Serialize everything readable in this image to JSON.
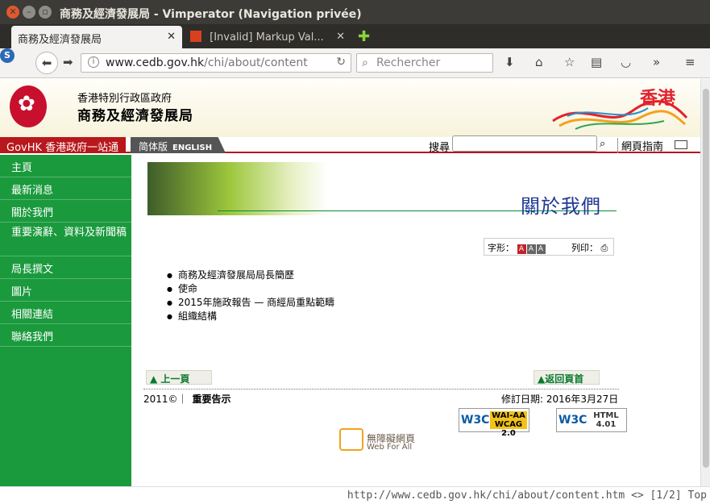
{
  "window": {
    "title": "商務及經濟發展局 - Vimperator (Navigation privée)"
  },
  "tabs": [
    {
      "label": "商務及經濟發展局"
    },
    {
      "label": "[Invalid] Markup Val..."
    }
  ],
  "navbar": {
    "url_host": "www.cedb.gov.hk",
    "url_path": "/chi/about/content",
    "search_placeholder": "Rechercher"
  },
  "site": {
    "gov_name": "香港特別行政區政府",
    "dept_name": "商務及經濟發展局",
    "brand": "香港",
    "govhk": "GovHK 香港政府一站通",
    "lang_sc": "简体版",
    "lang_en": "ENGLISH",
    "search_label": "搜尋",
    "site_guide": "網頁指南"
  },
  "sidebar": {
    "items": [
      {
        "label": "主頁"
      },
      {
        "label": "最新消息"
      },
      {
        "label": "關於我們"
      },
      {
        "label": "重要演辭、資料及新聞稿"
      },
      {
        "label": "局長撰文"
      },
      {
        "label": "圖片"
      },
      {
        "label": "相關連結"
      },
      {
        "label": "聯絡我們"
      }
    ]
  },
  "content": {
    "title": "關於我們",
    "font_label": "字形：",
    "print_label": "列印：",
    "links": [
      "商務及經濟發展局局長簡歷",
      "使命",
      "2015年施政報告 — 商經局重點範疇",
      "組織結構"
    ],
    "prev_page": "上一頁",
    "back_top": "返回頁首",
    "copyright": "2011©｜",
    "notices": "重要告示",
    "revised": "修訂日期: 2016年3月27日",
    "wai_badge": "WAI-AA WCAG 2.0",
    "html_badge": "HTML 4.01",
    "wfa_cn": "無障礙網頁",
    "wfa_en": "Web For All"
  },
  "status": {
    "text": "http://www.cedb.gov.hk/chi/about/content.htm <> [1/2] Top"
  },
  "colors": {
    "sidebar": "#1a9a3d",
    "govhk": "#b8171b",
    "title_blue": "#1f3a93"
  }
}
